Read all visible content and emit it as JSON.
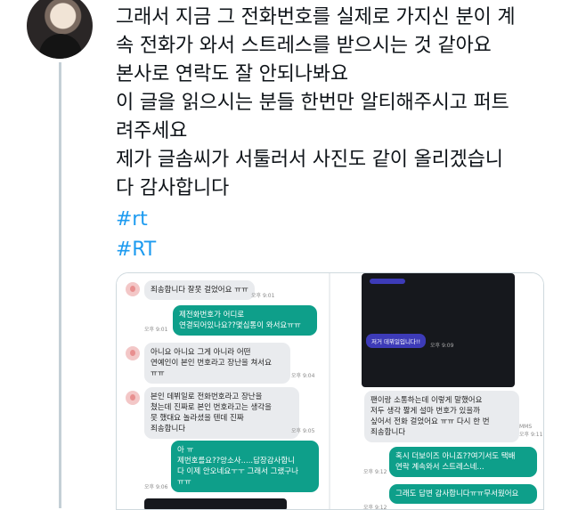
{
  "tweet": {
    "lines": [
      "그래서 지금 그 전화번호를 실제로 가지신 분이 계",
      "속 전화가 와서 스트레스를 받으시는 것 같아요",
      "본사로 연락도 잘 안되나봐요",
      "이 글을 읽으시는 분들 한번만 알티해주시고 퍼트",
      "려주세요",
      "제가 글솜씨가 서툴러서 사진도 같이 올리겠습니",
      "다 감사합니다"
    ],
    "hashtags": [
      "#rt",
      "#RT"
    ]
  },
  "chat_left": {
    "messages": [
      {
        "from": "in",
        "text": "죄송합니다 잘못 걸었어요 ㅠㅠ",
        "time": "오후 9:01"
      },
      {
        "from": "out",
        "text": "제전화번호가 어디로\n연결되어있나요??몇십통이 와서요ㅠㅠ",
        "time": "오후 9:01"
      },
      {
        "from": "in",
        "text": "아니요 아니요 그게 아니라 어떤\n연예인이 본인 번호라고 장난을 쳐서요\nㅠㅠ",
        "time": "오후 9:04"
      },
      {
        "from": "in",
        "text": "본인 데뷔일로 전화번호라고 장난을\n쳤는데 진짜로 본인 번호라고는 생각을\n못 했대요 놀라셨을 텐데 진짜\n죄송합니다",
        "time": "오후 9:05"
      },
      {
        "from": "out",
        "text": "아 ㅠ\n제번호를요??앙소사.....답장감사합니\n다 이제 안오네요ㅜㅜ 그래서 그랬구나\nㅠㅠ",
        "time": "오후 9:06"
      }
    ]
  },
  "chat_right": {
    "purple_small": "",
    "purple_label": "저거 데뷔일입니다!!",
    "purple_time": "오후 9:09",
    "messages": [
      {
        "from": "in",
        "text": "팬이랑 소통하는데 이렇게 말했어요\n저두 생각 짧게 설마 번호가 있을까\n싶어서 전화 걸었어요 ㅠㅠ 다시 한 번\n죄송합니다",
        "time": "MMS\n오후 9:11"
      },
      {
        "from": "out",
        "text": "혹시 더보이즈 아니죠??여기서도 택배\n연락 계속와서 스트레스네...",
        "time": "오후 9:12"
      },
      {
        "from": "out",
        "text": "그래도 답변 감사합니다ㅠㅠ무서웠어요",
        "time": "오후 9:12"
      }
    ]
  },
  "colors": {
    "bubble_out": "#0e9f8a",
    "bubble_in": "#e9ebee",
    "hashtag": "#1d9bf0",
    "purple": "#3d3bb8"
  }
}
